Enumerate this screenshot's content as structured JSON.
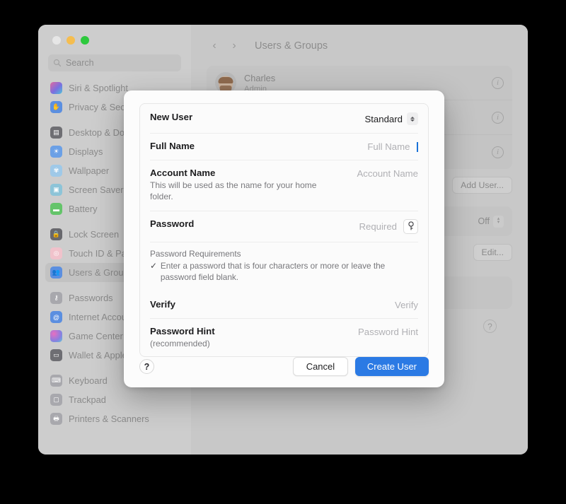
{
  "window": {
    "traffic_lights": [
      "close",
      "minimize",
      "zoom"
    ],
    "search_placeholder": "Search"
  },
  "sidebar": {
    "groups": [
      {
        "items": [
          {
            "label": "Siri & Spotlight",
            "icon": "siri-icon",
            "color": "#c86fb0",
            "selected": false
          },
          {
            "label": "Privacy & Security",
            "icon": "hand-icon",
            "color": "#5b8fe0",
            "selected": false
          }
        ]
      },
      {
        "items": [
          {
            "label": "Desktop & Dock",
            "icon": "desktop-icon",
            "color": "#6e6e73",
            "selected": false
          },
          {
            "label": "Displays",
            "icon": "display-icon",
            "color": "#6ba0e6",
            "selected": false
          },
          {
            "label": "Wallpaper",
            "icon": "wallpaper-icon",
            "color": "#9fc9e8",
            "selected": false
          },
          {
            "label": "Screen Saver",
            "icon": "screensaver-icon",
            "color": "#8dc4d8",
            "selected": false
          },
          {
            "label": "Battery",
            "icon": "battery-icon",
            "color": "#64c46a",
            "selected": false
          }
        ]
      },
      {
        "items": [
          {
            "label": "Lock Screen",
            "icon": "lock-icon",
            "color": "#68686d",
            "selected": false
          },
          {
            "label": "Touch ID & Password",
            "icon": "fingerprint-icon",
            "color": "#e89aa8",
            "selected": false
          },
          {
            "label": "Users & Groups",
            "icon": "users-icon",
            "color": "#5b8fe0",
            "selected": true
          }
        ]
      },
      {
        "items": [
          {
            "label": "Passwords",
            "icon": "key-icon",
            "color": "#a8a8ad",
            "selected": false
          },
          {
            "label": "Internet Accounts",
            "icon": "at-icon",
            "color": "#5b8fe0",
            "selected": false
          },
          {
            "label": "Game Center",
            "icon": "gamecenter-icon",
            "color": "#d07ad0",
            "selected": false
          },
          {
            "label": "Wallet & Apple Pay",
            "icon": "wallet-icon",
            "color": "#6e6e73",
            "selected": false
          }
        ]
      },
      {
        "items": [
          {
            "label": "Keyboard",
            "icon": "keyboard-icon",
            "color": "#a8a8ad",
            "selected": false
          },
          {
            "label": "Trackpad",
            "icon": "trackpad-icon",
            "color": "#a8a8ad",
            "selected": false
          },
          {
            "label": "Printers & Scanners",
            "icon": "printer-icon",
            "color": "#a8a8ad",
            "selected": false
          }
        ]
      }
    ]
  },
  "detail": {
    "nav": {
      "back": "‹",
      "forward": "›",
      "title": "Users & Groups"
    },
    "users": [
      {
        "name": "Charles",
        "role": "Admin",
        "info": "i"
      },
      {
        "name": "",
        "role": "",
        "info": "i"
      },
      {
        "name": "",
        "role": "",
        "info": "i"
      }
    ],
    "buttons": {
      "add_user": "Add User...",
      "edit": "Edit...",
      "guest_value": "Off",
      "help": "?"
    }
  },
  "sheet": {
    "rows": {
      "new_user": {
        "label": "New User",
        "value": "Standard"
      },
      "full_name": {
        "label": "Full Name",
        "placeholder": "Full Name"
      },
      "account_name": {
        "label": "Account Name",
        "sub": "This will be used as the name for your home folder.",
        "placeholder": "Account Name"
      },
      "password": {
        "label": "Password",
        "placeholder": "Required",
        "key_icon": "key-icon"
      },
      "requirements": {
        "title": "Password Requirements",
        "check": "✓",
        "text": "Enter a password that is four characters or more or leave the password field blank."
      },
      "verify": {
        "label": "Verify",
        "placeholder": "Verify"
      },
      "password_hint": {
        "label": "Password Hint",
        "sub": "(recommended)",
        "placeholder": "Password Hint"
      }
    },
    "footer": {
      "help": "?",
      "cancel": "Cancel",
      "create": "Create User"
    }
  }
}
